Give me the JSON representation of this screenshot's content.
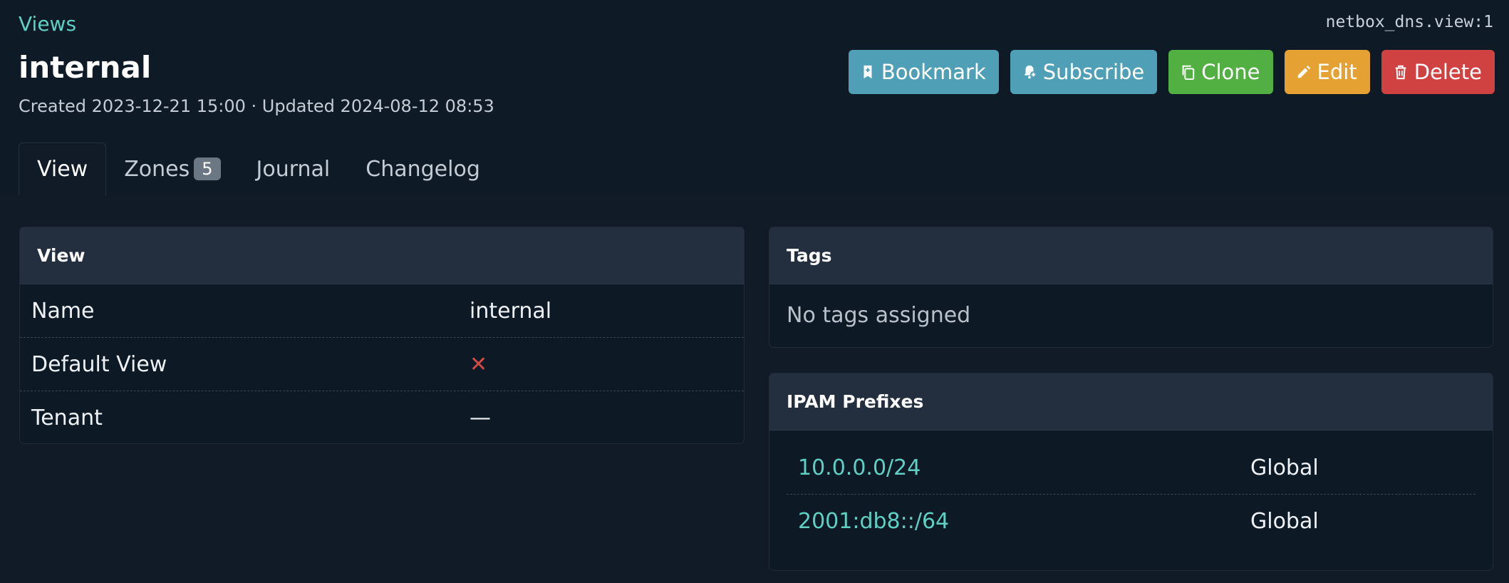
{
  "breadcrumb": {
    "label": "Views"
  },
  "object_id": "netbox_dns.view:1",
  "page": {
    "title": "internal",
    "meta": "Created 2023-12-21 15:00 · Updated 2024-08-12 08:53"
  },
  "actions": {
    "bookmark": "Bookmark",
    "subscribe": "Subscribe",
    "clone": "Clone",
    "edit": "Edit",
    "delete": "Delete"
  },
  "colors": {
    "bookmark": "#4fa0b6",
    "subscribe": "#4fa0b6",
    "clone": "#52b043",
    "edit": "#e6a133",
    "delete": "#cf4241",
    "link": "#5fd0c4"
  },
  "tabs": [
    {
      "label": "View",
      "active": true
    },
    {
      "label": "Zones",
      "badge": "5"
    },
    {
      "label": "Journal"
    },
    {
      "label": "Changelog"
    }
  ],
  "view_card": {
    "title": "View",
    "rows": [
      {
        "label": "Name",
        "value": "internal"
      },
      {
        "label": "Default View",
        "value": "✕"
      },
      {
        "label": "Tenant",
        "value": "—"
      }
    ]
  },
  "tags_card": {
    "title": "Tags",
    "empty_text": "No tags assigned"
  },
  "prefixes_card": {
    "title": "IPAM Prefixes",
    "rows": [
      {
        "prefix": "10.0.0.0/24",
        "vrf": "Global"
      },
      {
        "prefix": "2001:db8::/64",
        "vrf": "Global"
      }
    ]
  }
}
